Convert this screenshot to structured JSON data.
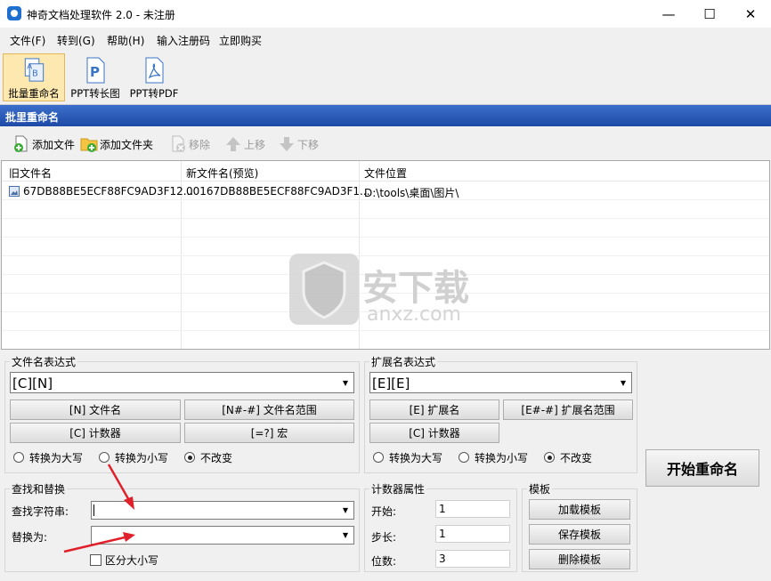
{
  "window": {
    "title": "神奇文档处理软件 2.0 - 未注册",
    "minimize_glyph": "—",
    "maximize_glyph": "☐",
    "close_glyph": "✕"
  },
  "menu": [
    "文件(F)",
    "转到(G)",
    "帮助(H)",
    "输入注册码",
    "立即购买"
  ],
  "toolbar": {
    "items": [
      {
        "label": "批量重命名",
        "icon": "batch-rename-icon",
        "active": true
      },
      {
        "label": "PPT转长图",
        "icon": "ppt-icon",
        "active": false
      },
      {
        "label": "PPT转PDF",
        "icon": "pdf-icon",
        "active": false
      }
    ]
  },
  "section_title": "批里重命名",
  "list_toolbar": {
    "add_file": "添加文件",
    "add_folder": "添加文件夹",
    "remove": "移除",
    "move_up": "上移",
    "move_down": "下移"
  },
  "file_list": {
    "headers": [
      "旧文件名",
      "新文件名(预览)",
      "文件位置"
    ],
    "rows": [
      {
        "old_name": "67DB88BE5ECF88FC9AD3F12...",
        "new_name": "00167DB88BE5ECF88FC9AD3F1...",
        "location": "D:\\tools\\桌面\\图片\\"
      }
    ]
  },
  "filename_expr": {
    "group_label": "文件名表达式",
    "value": "[C][N]",
    "buttons": [
      "[N] 文件名",
      "[N#-#] 文件名范围",
      "[C] 计数器",
      "[=?] 宏"
    ],
    "radios": [
      {
        "label": "转换为大写",
        "checked": false
      },
      {
        "label": "转换为小写",
        "checked": false
      },
      {
        "label": "不改变",
        "checked": true
      }
    ]
  },
  "ext_expr": {
    "group_label": "扩展名表达式",
    "value": "[E][E]",
    "buttons": [
      "[E] 扩展名",
      "[E#-#] 扩展名范围",
      "[C] 计数器"
    ],
    "radios": [
      {
        "label": "转换为大写",
        "checked": false
      },
      {
        "label": "转换为小写",
        "checked": false
      },
      {
        "label": "不改变",
        "checked": true
      }
    ]
  },
  "find_replace": {
    "group_label": "查找和替换",
    "find_label": "查找字符串:",
    "find_value": "",
    "replace_label": "替换为:",
    "replace_value": "",
    "case_label": "区分大小写"
  },
  "counter": {
    "group_label": "计数器属性",
    "start_label": "开始:",
    "start_value": "1",
    "step_label": "步长:",
    "step_value": "1",
    "digits_label": "位数:",
    "digits_value": "3"
  },
  "template": {
    "group_label": "模板",
    "load": "加载模板",
    "save": "保存模板",
    "delete": "删除模板"
  },
  "start_button": "开始重命名",
  "watermark": {
    "text": "安下载",
    "subtext": "anxz.com"
  },
  "colors": {
    "header_blue": "#1d4aa6",
    "active_tool_bg": "#fde9b0",
    "arrow_red": "#e0202a"
  }
}
